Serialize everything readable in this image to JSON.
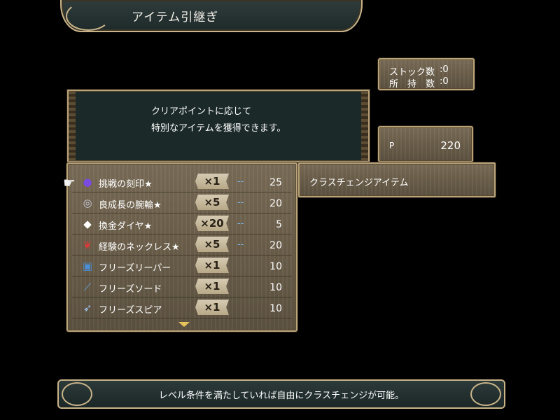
{
  "title": "アイテム引継ぎ",
  "stock": {
    "stock_label": "ストック数",
    "stock_value": ":0",
    "held_label": "所　持　数",
    "held_value": ":0"
  },
  "description": {
    "line1": "クリアポイントに応じて",
    "line2": "特別なアイテムを獲得できます。"
  },
  "points": {
    "label": "P",
    "value": "220"
  },
  "category": {
    "label": "クラスチェンジアイテム"
  },
  "items": [
    {
      "icon": "purple-orb-icon",
      "glyph": "●",
      "color": "#7a4be0",
      "name": "挑戦の刻印★",
      "qty": "×1",
      "dash": "--",
      "cost": "25"
    },
    {
      "icon": "bracelet-icon",
      "glyph": "◎",
      "color": "#c7c7d8",
      "name": "良成長の腕輪★",
      "qty": "×5",
      "dash": "--",
      "cost": "20"
    },
    {
      "icon": "diamond-icon",
      "glyph": "◆",
      "color": "#ffffff",
      "name": "換金ダイヤ★",
      "qty": "×20",
      "dash": "--",
      "cost": "5"
    },
    {
      "icon": "necklace-icon",
      "glyph": "❦",
      "color": "#d83a3a",
      "name": "経験のネックレス★",
      "qty": "×5",
      "dash": "--",
      "cost": "20"
    },
    {
      "icon": "book-icon",
      "glyph": "▣",
      "color": "#4a8fd6",
      "name": "フリーズリーパー",
      "qty": "×1",
      "dash": "",
      "cost": "10"
    },
    {
      "icon": "sword-icon",
      "glyph": "⟋",
      "color": "#6aa0e6",
      "name": "フリーズソード",
      "qty": "×1",
      "dash": "",
      "cost": "10"
    },
    {
      "icon": "spear-icon",
      "glyph": "➶",
      "color": "#9cc6f0",
      "name": "フリーズスピア",
      "qty": "×1",
      "dash": "",
      "cost": "10"
    }
  ],
  "footer": {
    "text": "レベル条件を満たしていれば自由にクラスチェンジが可能。"
  }
}
